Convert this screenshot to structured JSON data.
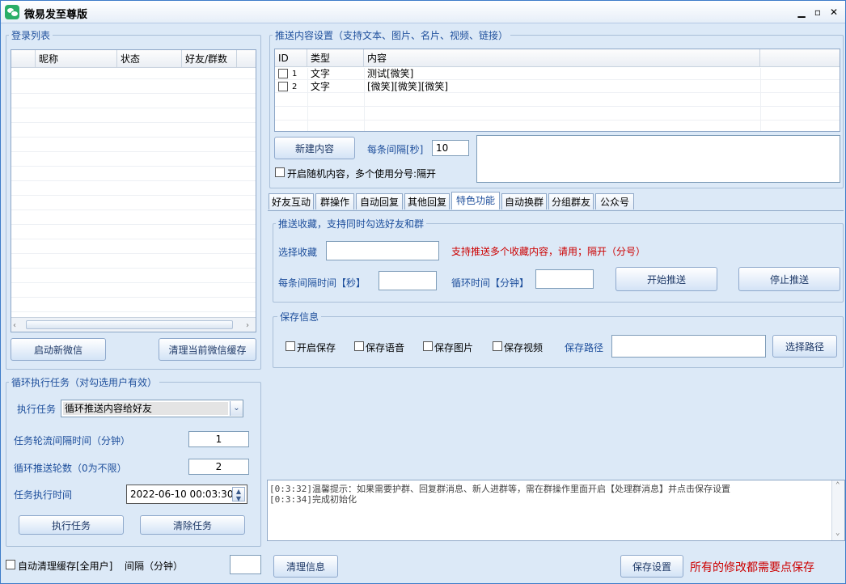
{
  "window": {
    "title": "微易发至尊版"
  },
  "login_list": {
    "title": "登录列表",
    "columns": [
      "昵称",
      "状态",
      "好友/群数"
    ],
    "start_button": "启动新微信",
    "clear_cache_button": "清理当前微信缓存"
  },
  "loop_task": {
    "title": "循环执行任务（对勾选用户有效）",
    "task_label": "执行任务",
    "task_value": "循环推送内容给好友",
    "interval_label": "任务轮流间隔时间（分钟）",
    "interval_value": "1",
    "rounds_label": "循环推送轮数（0为不限）",
    "rounds_value": "2",
    "time_label": "任务执行时间",
    "time_value": "2022-06-10 00:03:30",
    "exec_button": "执行任务",
    "clear_button": "清除任务"
  },
  "bottom_left": {
    "auto_clear_label": "自动清理缓存[全用户]",
    "interval_label": "间隔（分钟）",
    "interval_value": ""
  },
  "push_settings": {
    "title": "推送内容设置（支持文本、图片、名片、视频、链接）",
    "columns": [
      "ID",
      "类型",
      "内容"
    ],
    "rows": [
      {
        "id": "1",
        "type": "文字",
        "content": "测试[微笑]"
      },
      {
        "id": "2",
        "type": "文字",
        "content": "[微笑][微笑][微笑]"
      }
    ],
    "new_button": "新建内容",
    "interval_label": "每条间隔[秒]",
    "interval_value": "10",
    "random_label": "开启随机内容，多个使用分号:隔开"
  },
  "tabs": [
    {
      "label": "好友互动",
      "active": false
    },
    {
      "label": "群操作",
      "active": false
    },
    {
      "label": "自动回复",
      "active": false
    },
    {
      "label": "其他回复",
      "active": false
    },
    {
      "label": "特色功能",
      "active": true
    },
    {
      "label": "自动换群",
      "active": false
    },
    {
      "label": "分组群友",
      "active": false
    },
    {
      "label": "公众号",
      "active": false
    }
  ],
  "favorites": {
    "title": "推送收藏，支持同时勾选好友和群",
    "select_label": "选择收藏",
    "select_value": "",
    "hint": "支持推送多个收藏内容，请用；隔开（分号）",
    "interval_label": "每条间隔时间【秒】",
    "interval_value": "",
    "loop_label": "循环时间【分钟】",
    "loop_value": "",
    "start_button": "开始推送",
    "stop_button": "停止推送"
  },
  "save_info": {
    "title": "保存信息",
    "options": [
      "开启保存",
      "保存语音",
      "保存图片",
      "保存视频"
    ],
    "path_label": "保存路径",
    "path_value": "",
    "choose_button": "选择路径"
  },
  "log": {
    "lines": [
      "[0:3:32]温馨提示：如果需要护群、回复群消息、新人进群等，需在群操作里面开启【处理群消息】并点击保存设置",
      "[0:3:34]完成初始化"
    ]
  },
  "footer": {
    "clear_button": "清理信息",
    "save_button": "保存设置",
    "note": "所有的修改都需要点保存"
  },
  "colors": {
    "accent": "#1e4f9c",
    "warning": "#cc0000",
    "frame": "#dce9f7"
  }
}
